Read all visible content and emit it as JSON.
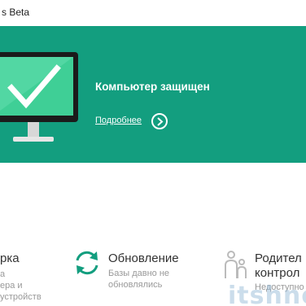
{
  "window": {
    "title": "s Beta"
  },
  "hero": {
    "status_title": "Компьютер защищен",
    "details_link": "Подробнее",
    "background_color": "#139e7f"
  },
  "tiles": [
    {
      "title": "рка",
      "subtitle_lines": [
        "а",
        "ера и",
        "устройств"
      ]
    },
    {
      "title": "Обновление",
      "subtitle_lines": [
        "Базы давно не",
        "обновлялись"
      ],
      "icon": "refresh-icon"
    },
    {
      "title_lines": [
        "Родител",
        "контрол"
      ],
      "subtitle_lines": [
        "Недоступно"
      ],
      "icon": "family-icon"
    }
  ],
  "watermark": "itshne",
  "colors": {
    "accent": "#139e7f",
    "subtitle": "#999999"
  }
}
